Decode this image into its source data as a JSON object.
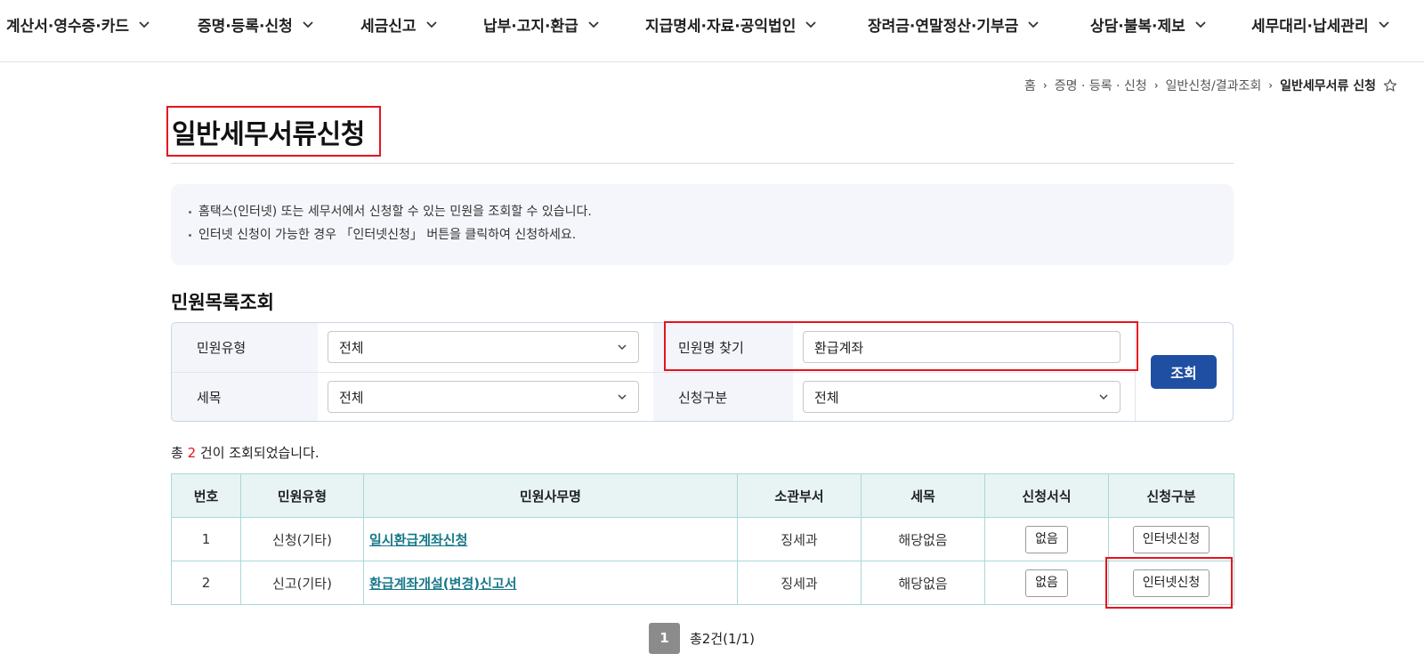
{
  "nav": {
    "items": [
      {
        "label": "계산서·영수증·카드"
      },
      {
        "label": "증명·등록·신청"
      },
      {
        "label": "세금신고"
      },
      {
        "label": "납부·고지·환급"
      },
      {
        "label": "지급명세·자료·공익법인"
      },
      {
        "label": "장려금·연말정산·기부금"
      },
      {
        "label": "상담·불복·제보"
      },
      {
        "label": "세무대리·납세관리"
      }
    ]
  },
  "breadcrumb": {
    "home": "홈",
    "level1": "증명 · 등록 · 신청",
    "level2": "일반신청/결과조회",
    "current": "일반세무서류 신청"
  },
  "page": {
    "title": "일반세무서류신청"
  },
  "info": {
    "lines": [
      "홈택스(인터넷) 또는 세무서에서 신청할 수 있는 민원을 조회할 수 있습니다.",
      "인터넷 신청이 가능한 경우 「인터넷신청」 버튼을 클릭하여 신청하세요."
    ]
  },
  "search": {
    "section_title": "민원목록조회",
    "type_label": "민원유형",
    "type_value": "전체",
    "name_label": "민원명 찾기",
    "name_value": "환급계좌",
    "tax_label": "세목",
    "tax_value": "전체",
    "apply_label": "신청구분",
    "apply_value": "전체",
    "button": "조회"
  },
  "results": {
    "prefix": "총",
    "count": "2",
    "suffix": "건이 조회되었습니다."
  },
  "table": {
    "headers": [
      "번호",
      "민원유형",
      "민원사무명",
      "소관부서",
      "세목",
      "신청서식",
      "신청구분"
    ],
    "rows": [
      {
        "no": "1",
        "type": "신청(기타)",
        "name": "일시환급계좌신청",
        "dept": "징세과",
        "tax": "해당없음",
        "form": "없음",
        "apply": "인터넷신청"
      },
      {
        "no": "2",
        "type": "신고(기타)",
        "name": "환급계좌개설(변경)신고서",
        "dept": "징세과",
        "tax": "해당없음",
        "form": "없음",
        "apply": "인터넷신청"
      }
    ]
  },
  "pagination": {
    "current": "1",
    "summary": "총2건(1/1)"
  },
  "colors": {
    "highlight": "#e5141e",
    "primary_button": "#1f4fa3",
    "link": "#17788a",
    "table_header_bg": "#e8f4f4"
  }
}
